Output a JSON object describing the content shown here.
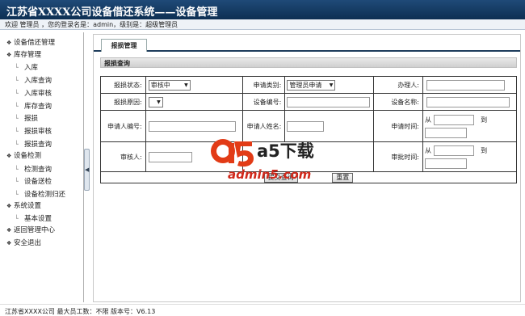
{
  "header": {
    "title": "江苏省XXXX公司设备借还系统——设备管理",
    "welcome": "欢迎 管理员 ，您的登录名是：admin，级别是：超级管理员"
  },
  "sidebar": {
    "items": [
      {
        "label": "设备借还管理",
        "level": 0
      },
      {
        "label": "库存管理",
        "level": 0
      },
      {
        "label": "入库",
        "level": 1
      },
      {
        "label": "入库查询",
        "level": 1
      },
      {
        "label": "入库审核",
        "level": 1
      },
      {
        "label": "库存查询",
        "level": 1
      },
      {
        "label": "报损",
        "level": 1
      },
      {
        "label": "报损审核",
        "level": 1
      },
      {
        "label": "报损查询",
        "level": 1
      },
      {
        "label": "设备检测",
        "level": 0
      },
      {
        "label": "检测查询",
        "level": 1
      },
      {
        "label": "设备送检",
        "level": 1
      },
      {
        "label": "设备检测归还",
        "level": 1
      },
      {
        "label": "系统设置",
        "level": 0
      },
      {
        "label": "基本设置",
        "level": 1
      },
      {
        "label": "返回管理中心",
        "level": 0
      },
      {
        "label": "安全退出",
        "level": 0
      }
    ],
    "collapse_icon": "◀"
  },
  "main": {
    "tab_label": "报损管理",
    "section_title": "报损查询",
    "form": {
      "status_label": "报损状态:",
      "status_value": "审核中",
      "apply_type_label": "申请类别:",
      "apply_type_value": "管理员申请",
      "handler_label": "办理人:",
      "reason_label": "报损原因:",
      "reason_value": "",
      "device_no_label": "设备编号:",
      "device_name_label": "设备名称:",
      "applicant_no_label": "申请人编号:",
      "applicant_name_label": "申请人姓名:",
      "apply_time_label": "申请时间:",
      "reviewer_label": "审核人:",
      "approve_time_label": "审批时间:",
      "from_label": "从",
      "to_label": "到",
      "submit_label": "提交查询",
      "reset_label": "重置"
    }
  },
  "watermark": {
    "brand": "a5下载",
    "site": "admin5.com"
  },
  "footer": {
    "text": "江苏省XXXX公司 最大员工数：不限 版本号：V6.13"
  }
}
